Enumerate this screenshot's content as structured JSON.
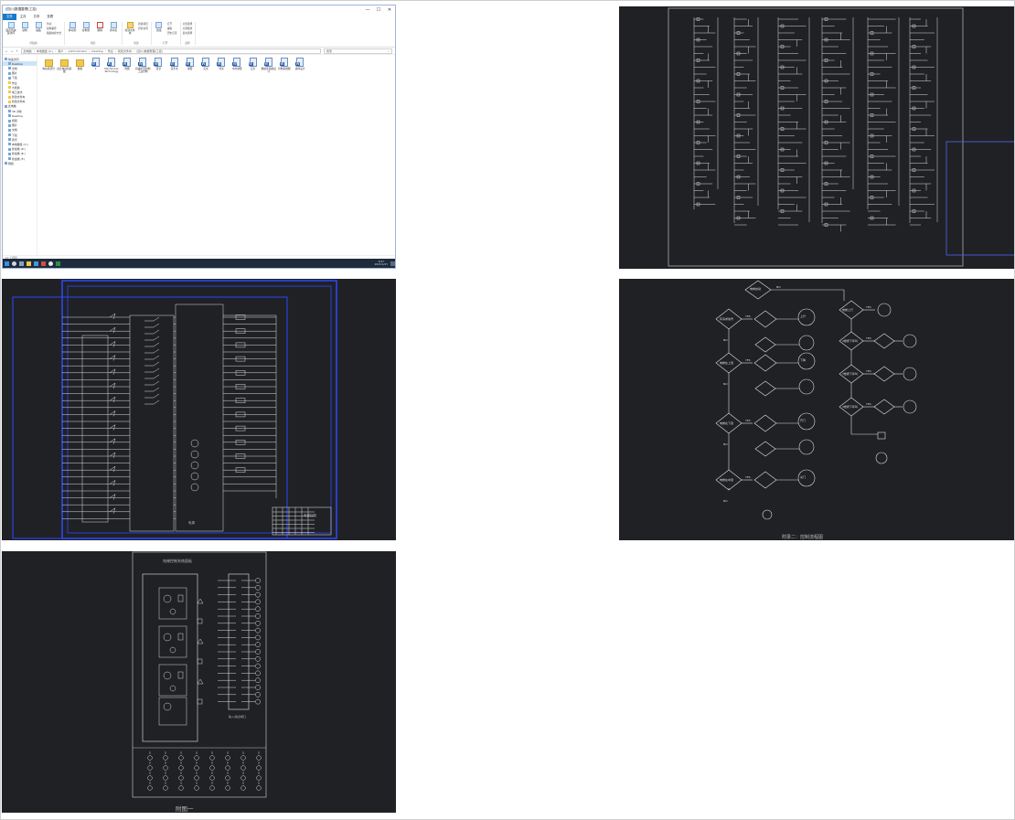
{
  "explorer": {
    "title": "(四川)数据整理(工控)",
    "window_buttons": [
      "—",
      "☐",
      "✕"
    ],
    "tabs": [
      "文件",
      "主页",
      "共享",
      "查看"
    ],
    "ribbon_groups": [
      {
        "name": "剪贴板",
        "items": [
          "固定到快速访问",
          "复制",
          "粘贴"
        ],
        "small": [
          "剪切",
          "复制路径",
          "粘贴快捷方式"
        ]
      },
      {
        "name": "组织",
        "items": [
          "移动到",
          "复制到",
          "删除",
          "重命名"
        ],
        "small": []
      },
      {
        "name": "新建",
        "items": [
          "新建文件夹"
        ],
        "small": [
          "新建项目",
          "轻松访问"
        ]
      },
      {
        "name": "打开",
        "items": [
          "属性"
        ],
        "small": [
          "打开",
          "编辑",
          "历史记录"
        ]
      },
      {
        "name": "选择",
        "items": [],
        "small": [
          "全部选择",
          "全部取消",
          "反向选择"
        ]
      }
    ],
    "address_path": [
      "此电脑",
      "本地磁盘 (C:)",
      "用户",
      "Administrator",
      "Desktop",
      "作业",
      "新建文件夹",
      "(四川)数据整理(工控)"
    ],
    "search_placeholder": "搜索",
    "nav_items": [
      {
        "label": "快速访问",
        "indent": false,
        "icon": "star-icon",
        "selected": false
      },
      {
        "label": "Desktop",
        "indent": true,
        "icon": "desktop-icon",
        "selected": true
      },
      {
        "label": "文档",
        "indent": true,
        "icon": "document-icon",
        "selected": false
      },
      {
        "label": "图片",
        "indent": true,
        "icon": "picture-icon",
        "selected": false
      },
      {
        "label": "下载",
        "indent": true,
        "icon": "download-icon",
        "selected": false
      },
      {
        "label": "作业",
        "indent": true,
        "icon": "folder-icon",
        "selected": false
      },
      {
        "label": "大赛题",
        "indent": true,
        "icon": "folder-icon",
        "selected": false
      },
      {
        "label": "电工技术",
        "indent": true,
        "icon": "folder-icon",
        "selected": false
      },
      {
        "label": "新建文件夹",
        "indent": true,
        "icon": "folder-icon",
        "selected": false
      },
      {
        "label": "新建文件夹",
        "indent": true,
        "icon": "folder-icon",
        "selected": false
      },
      {
        "label": "此电脑",
        "indent": false,
        "icon": "computer-icon",
        "selected": false
      },
      {
        "label": "3D 对象",
        "indent": true,
        "icon": "cube-icon",
        "selected": false
      },
      {
        "label": "Desktop",
        "indent": true,
        "icon": "desktop-icon",
        "selected": false
      },
      {
        "label": "视频",
        "indent": true,
        "icon": "video-icon",
        "selected": false
      },
      {
        "label": "图片",
        "indent": true,
        "icon": "picture-icon",
        "selected": false
      },
      {
        "label": "文档",
        "indent": true,
        "icon": "document-icon",
        "selected": false
      },
      {
        "label": "下载",
        "indent": true,
        "icon": "download-icon",
        "selected": false
      },
      {
        "label": "音乐",
        "indent": true,
        "icon": "music-icon",
        "selected": false
      },
      {
        "label": "本地磁盘 (C:)",
        "indent": true,
        "icon": "drive-icon",
        "selected": false
      },
      {
        "label": "新加卷 (D:)",
        "indent": true,
        "icon": "drive-icon",
        "selected": false
      },
      {
        "label": "新加卷 (E:)",
        "indent": true,
        "icon": "drive-icon",
        "selected": false
      },
      {
        "label": "新加卷 (F:)",
        "indent": true,
        "icon": "drive-icon",
        "selected": false
      },
      {
        "label": "网络",
        "indent": false,
        "icon": "network-icon",
        "selected": false
      }
    ],
    "files": [
      {
        "label": "电动机部分",
        "type": "folder"
      },
      {
        "label": "四台电动机基础",
        "type": "folder"
      },
      {
        "label": "数据",
        "type": "folder"
      },
      {
        "label": "1",
        "type": "doc"
      },
      {
        "label": "Mechanical Technology",
        "type": "doc"
      },
      {
        "label": "附图",
        "type": "doc"
      },
      {
        "label": "机械手臂控制工业控制",
        "type": "doc"
      },
      {
        "label": "目录",
        "type": "doc"
      },
      {
        "label": "任务书",
        "type": "doc"
      },
      {
        "label": "摘要",
        "type": "doc"
      },
      {
        "label": "英文",
        "type": "doc"
      },
      {
        "label": "外文",
        "type": "doc"
      },
      {
        "label": "中文摘要",
        "type": "doc"
      },
      {
        "label": "正文",
        "type": "doc"
      },
      {
        "label": "数据库系统设计",
        "type": "doc"
      },
      {
        "label": "控制系统图",
        "type": "doc"
      },
      {
        "label": "总体设计",
        "type": "doc"
      }
    ],
    "status": "17 个项目",
    "taskbar": {
      "time": "9:47",
      "date": "2021/1/27"
    }
  },
  "panels": {
    "plc_io_diagram": {
      "title_block": "电梯控制",
      "bottom_label": "电源"
    },
    "flowchart": {
      "caption": "附录二：控制流程图",
      "yes": "YES",
      "no": "NO",
      "left_decisions": [
        "有请求信号",
        "电梯在上层",
        "电梯在下层",
        "电梯在中层"
      ],
      "right_decisions": [
        "电梯上行",
        "2楼按下呼叫",
        "3楼按下呼叫",
        "4楼按下呼叫"
      ],
      "actions": [
        "上升",
        "下降",
        "开门",
        "关门"
      ],
      "start": "电梯启动"
    },
    "control_panel": {
      "title": "电梯控制系统面板",
      "caption": "附图一",
      "io_label": "输入/输出端口"
    }
  }
}
